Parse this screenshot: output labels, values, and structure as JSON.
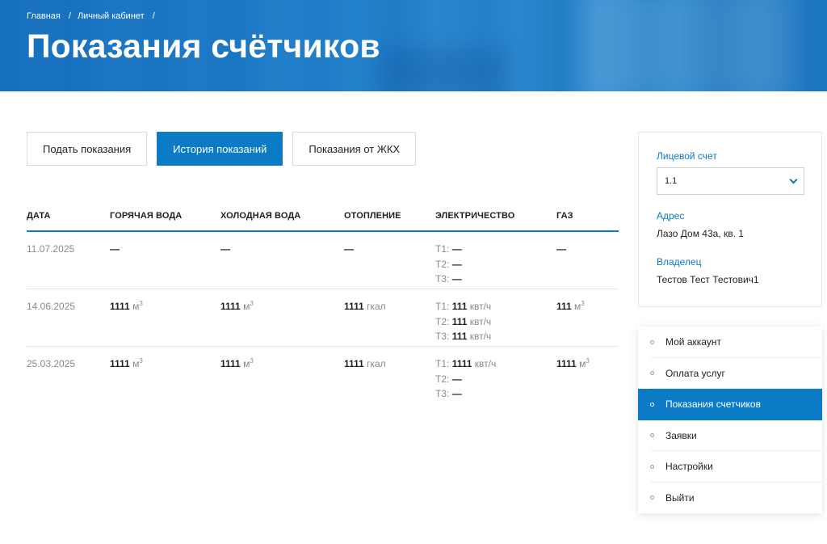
{
  "breadcrumb": {
    "home": "Главная",
    "cabinet": "Личный кабинет",
    "sep": "/"
  },
  "page_title": "Показания счётчиков",
  "tabs": [
    {
      "label": "Подать показания",
      "active": false
    },
    {
      "label": "История показаний",
      "active": true
    },
    {
      "label": "Показания от ЖКХ",
      "active": false
    }
  ],
  "table": {
    "headers": [
      "Дата",
      "Горячая вода",
      "Холодная вода",
      "Отопление",
      "Электричество",
      "Газ"
    ],
    "rows": [
      {
        "date": "11.07.2025",
        "hot": {
          "value": "—",
          "unit": "",
          "sup": ""
        },
        "cold": {
          "value": "—",
          "unit": "",
          "sup": ""
        },
        "heat": {
          "value": "—",
          "unit": ""
        },
        "el": [
          {
            "label": "Т1:",
            "value": "—",
            "unit": ""
          },
          {
            "label": "Т2:",
            "value": "—",
            "unit": ""
          },
          {
            "label": "Т3:",
            "value": "—",
            "unit": ""
          }
        ],
        "gas": {
          "value": "—",
          "unit": "",
          "sup": ""
        }
      },
      {
        "date": "14.06.2025",
        "hot": {
          "value": "1111",
          "unit": "м",
          "sup": "3"
        },
        "cold": {
          "value": "1111",
          "unit": "м",
          "sup": "3"
        },
        "heat": {
          "value": "1111",
          "unit": "гкал"
        },
        "el": [
          {
            "label": "Т1:",
            "value": "111",
            "unit": "квт/ч"
          },
          {
            "label": "Т2:",
            "value": "111",
            "unit": "квт/ч"
          },
          {
            "label": "Т3:",
            "value": "111",
            "unit": "квт/ч"
          }
        ],
        "gas": {
          "value": "111",
          "unit": "м",
          "sup": "3"
        }
      },
      {
        "date": "25.03.2025",
        "hot": {
          "value": "1111",
          "unit": "м",
          "sup": "3"
        },
        "cold": {
          "value": "1111",
          "unit": "м",
          "sup": "3"
        },
        "heat": {
          "value": "1111",
          "unit": "гкал"
        },
        "el": [
          {
            "label": "Т1:",
            "value": "1111",
            "unit": "квт/ч"
          },
          {
            "label": "Т2:",
            "value": "—",
            "unit": ""
          },
          {
            "label": "Т3:",
            "value": "—",
            "unit": ""
          }
        ],
        "gas": {
          "value": "1111",
          "unit": "м",
          "sup": "3"
        }
      }
    ]
  },
  "account": {
    "account_label": "Лицевой счет",
    "account_value": "1.1",
    "address_label": "Адрес",
    "address_value": "Лазо Дом 43а, кв. 1",
    "owner_label": "Владелец",
    "owner_value": "Тестов Тест Тестович1"
  },
  "menu": [
    {
      "label": "Мой аккаунт",
      "active": false
    },
    {
      "label": "Оплата услуг",
      "active": false
    },
    {
      "label": "Показания счетчиков",
      "active": true
    },
    {
      "label": "Заявки",
      "active": false
    },
    {
      "label": "Настройки",
      "active": false
    },
    {
      "label": "Выйти",
      "active": false
    }
  ],
  "colors": {
    "accent": "#0a7bc4",
    "muted": "#888888"
  }
}
